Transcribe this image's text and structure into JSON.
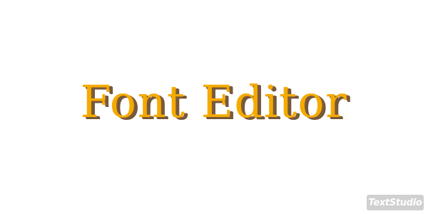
{
  "headline": {
    "text": "Font Editor",
    "fill_color": "#f5aa00",
    "shadow_color": "#7a5a3a"
  },
  "watermark": {
    "text": "TextStudio",
    "background_color": "#d0d0d0"
  },
  "background_color": "#ffffff"
}
